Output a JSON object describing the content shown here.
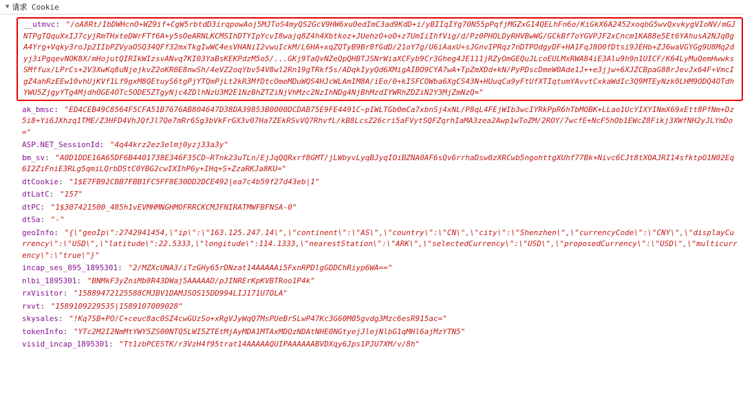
{
  "header": {
    "title": "请求 Cookie"
  },
  "cookies": [
    {
      "key": "__utmvc",
      "value": "\"/oA8Rt/IbDWHcnO+WZ9if+CgW5rbtdD3irqpowAoj5MJToS4myQS2GcV9HW6xuOedImC3ad9KdD+i/yBIIqIYg70N55pPqfjMGZxG14QELhFn6o/KiGkX6A2452xoqbG5wvQxvkygVIoNV/mGJNTPgTQquXxIJ7cyjRmTHxteDWrFTf6A+y5sOeARNLKCMSIhDTYIpYcvI8wajq8Z4h4Xbtkoz+JUehzO+oO+z7UmIiIhfVig/d/Pz0PHOLDyRHVBwWG/GCkBf7oYGVPJF2xCncm1KA88e5Et6YAhusA2NJq0gA4Yrg+Vqky3roJp2IIbPZVyaOSQ34QFf32mxTkgIwWC4esVHANiI2vwuIckM/L6HA+xqZQTyB9Br8fGdD/21oY7g/U6iAaxU+sJGnvIPRqz7nDTPOdgyDF+HA1FqJ8O0fDtsi9JEHb+ZJ6waVGYGg9U8Mq2dyj3iPgqevNOK8X/mHojutQIRIkWIzsvANvq7KI03YaBsKEKPdzM5o5/...GKj9TaQvNZeQpQHBTJSNrWiaXCFyb9Cr3Gheg4JE111jRZyOmGEQuJLcoEULMxRWA84iE3Alu9h9n1UICF/K64LyMuQemHwwksSMffux/LPrCs+2V3XwKq8uNjejkvZ2oKR0E8nwSh/4eVZ2oqYbv54V8wl2Rn19gTRkf5s/ADqkIyyQd6XMigAIBO9CYA7wA+TpZmXDd+kN/PyPDscDmeW0Ade1J++e3jjw+6XJZCBpaG88rJevJx64F+VmcIgZ4ahRzEEw10vhUjKVf1Lf9gxM8QEtuyS6tgPjYTQmPjLt2kR3MfDtcOmeMDuWQS4HJcWLAmIM8A/iEo/0+kISFCOWba6XgCS43N+HUuqCa9yFtUfXTIqtumYAvvtCxkaWdIc3Q9MTEyNzk0LHM9ODQ4OTdhYWU5ZjgyYTg4MjdhOGE4OTc5ODE5ZTgyNjc4ZDlhNzU3M2E1NzBhZTZiNjVhMzc2NzIhNDg4NjBhMzdIYWRhZDZiN2Y3MjZmNzQ=\"",
      "highlighted": true
    },
    {
      "key": "ak_bmsc",
      "value": "\"ED4CEB49C8564F5CFA51B7676AB804647D38DA39853B0000DCDAB75E9FE4491C~pIWLTGb0mCa7xbnSj4xNL/P8qL4FEjWIb3wcIYRkPpR6hTbMOBK+LLao1UcYIXYINmX69xEtt8PfNm+Dz5i8+Yi6JXhzq1TME/Z3HFD4VhJQfJl7Qe7mRr6Sg3bVkFrGX3v07Ha7ZEkRSvVQ7RhvfL/kB8LcsZ26cri5aFVytSQFZqrhIaMA3zea2Awp1wToZM/2ROY/7wcfE+NcF5hOb1EWcZ8Fikj3XWfNH2yJLYmDo=\"",
      "highlighted": false
    },
    {
      "key": "ASP.NET_SessionId",
      "value": "\"4q44krz2ez3elmj0yzj33a3y\"",
      "highlighted": false
    },
    {
      "key": "bm_sv",
      "value": "\"A0D1DDE16A65DF6B4401738E346F35CD~RTnk23uTLn/EjJqQQRxrf8GMT/jLWbyvLyqBJyqIOiBZNA0AF6sQv6rrhaDsw0zXRCwb5ngohttgXUhf77Bk+Nivc6CJt8tXOAJRI14sfktpO1N02Eq6I2ZiFniE3RLg5qmiLQrbDStC0YBG2cwIXIhP6y+IHq+S+ZzaRKJa8KU=\"",
      "highlighted": false
    },
    {
      "key": "dtCookie",
      "value": "\"1$E7FB92CBB7FBB1FC5FF8E30DD2DCE492|ea7c4b59f27d43eb|1\"",
      "highlighted": false
    },
    {
      "key": "dtLatC",
      "value": "\"157\"",
      "highlighted": false
    },
    {
      "key": "dtPC",
      "value": "\"1$307421500_485h1vEVMHMNGHMOFRRCKCMJFNIRATMWFBFNSA-0\"",
      "highlighted": false
    },
    {
      "key": "dtSa",
      "value": "\"-\"",
      "highlighted": false
    },
    {
      "key": "geoInfo",
      "value": "\"{\\\"geoIp\\\":2742941454,\\\"ip\\\":\\\"163.125.247.14\\\",\\\"continent\\\":\\\"AS\\\",\\\"country\\\":\\\"CN\\\",\\\"city\\\":\\\"Shenzhen\\\",\\\"currencyCode\\\":\\\"CNY\\\",\\\"displayCurrency\\\":\\\"USD\\\",\\\"latitude\\\":22.5333,\\\"longitude\\\":114.1333,\\\"nearestStation\\\":\\\"ARK\\\",\\\"selectedCurrency\\\":\\\"USD\\\",\\\"proposedCurrency\\\":\\\"USD\\\",\\\"multicurrency\\\":\\\"true\\\"}\"",
      "highlighted": false
    },
    {
      "key": "incap_ses_895_1895301",
      "value": "\"2/MZXcUNA3/iTzGHy65rDNzat14AAAAAi5FxnRPDlgGDDChRiyp6WA==\"",
      "highlighted": false
    },
    {
      "key": "nlbi_1895301",
      "value": "\"BNMkF3yZniMb8R43DWaj5AAAAAD/pJINRErKpKVBTRoo1P4k\"",
      "highlighted": false
    },
    {
      "key": "rxVisitor",
      "value": "\"15889472125588CMJBV1DAMJSOS15DD994LIJ171U7OLA\"",
      "highlighted": false
    },
    {
      "key": "rxvt",
      "value": "\"1589109229535|1589107009028\"",
      "highlighted": false
    },
    {
      "key": "skysales",
      "value": "\"!Kq7SB+PO/C+ceuc8ac0SZ4cwGUzSo+xRgVJyWqQ7MsPUeBrSLwP47Kc3G60M05gvdg3Mzc6esR915ac=\"",
      "highlighted": false
    },
    {
      "key": "tokenInfo",
      "value": "\"YTc2M2I2NmMtYWY5ZS00NTQ5LWI5ZTEtMjAyMDA1MTAxMDQzNDAtNHE0NGtyejJlejNlbG1qMHl6ajMzYTN5\"",
      "highlighted": false
    },
    {
      "key": "visid_incap_1895301",
      "value": "\"Tt1zbPCESTK/r3VzH4f95trat14AAAAAQUIPAAAAAABVDXqy6Jps1PJU7XM/v/8h\"",
      "highlighted": false
    }
  ]
}
